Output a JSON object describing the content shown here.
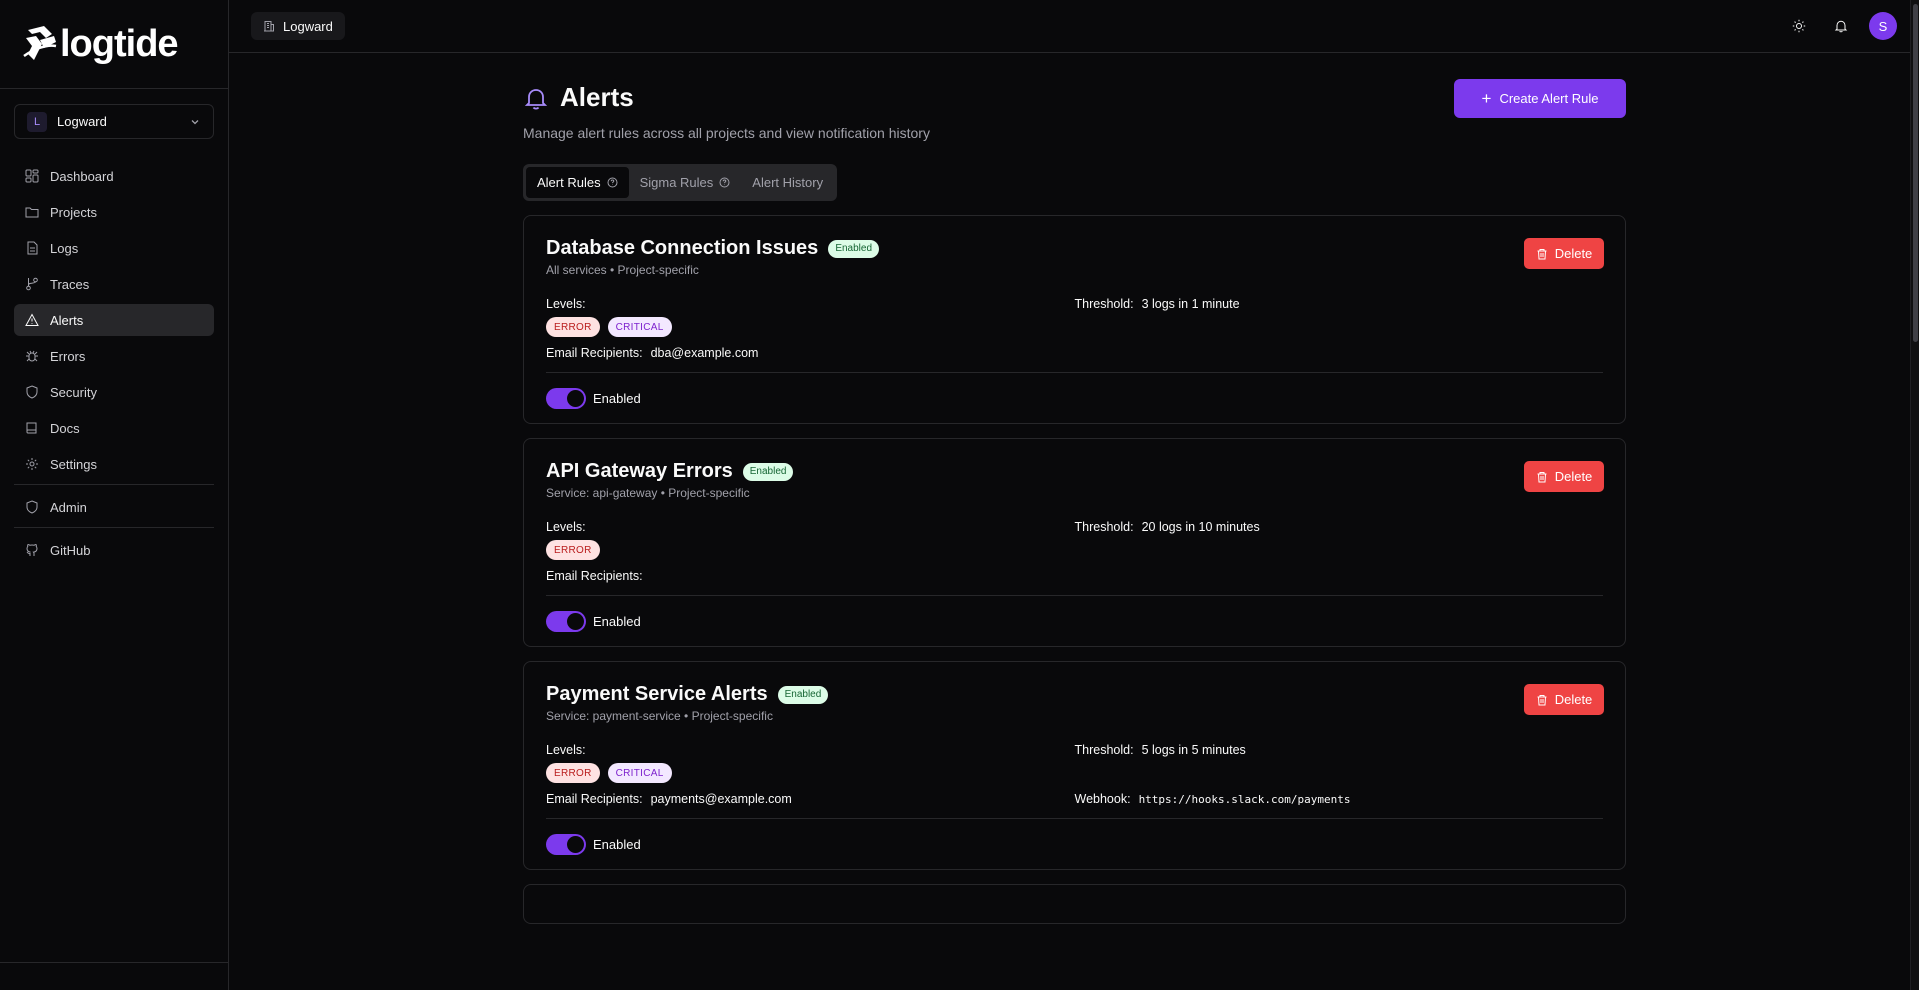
{
  "app": {
    "brand": "logtide"
  },
  "org_selector": {
    "initial": "L",
    "name": "Logward"
  },
  "sidebar": {
    "items": [
      {
        "label": "Dashboard",
        "icon": "dashboard-icon"
      },
      {
        "label": "Projects",
        "icon": "folder-icon"
      },
      {
        "label": "Logs",
        "icon": "file-text-icon"
      },
      {
        "label": "Traces",
        "icon": "git-branch-icon"
      },
      {
        "label": "Alerts",
        "icon": "alert-triangle-icon"
      },
      {
        "label": "Errors",
        "icon": "bug-icon"
      },
      {
        "label": "Security",
        "icon": "shield-icon"
      },
      {
        "label": "Docs",
        "icon": "book-icon"
      },
      {
        "label": "Settings",
        "icon": "gear-icon"
      }
    ],
    "admin": "Admin",
    "github": "GitHub"
  },
  "topbar": {
    "breadcrumb": "Logward",
    "user_initial": "S"
  },
  "page": {
    "title": "Alerts",
    "subtitle": "Manage alert rules across all projects and view notification history",
    "create_button": "Create Alert Rule"
  },
  "tabs": [
    "Alert Rules",
    "Sigma Rules",
    "Alert History"
  ],
  "labels": {
    "levels": "Levels:",
    "threshold": "Threshold:",
    "email": "Email Recipients:",
    "webhook": "Webhook:",
    "enabled_badge": "Enabled",
    "delete": "Delete",
    "toggle": "Enabled"
  },
  "rules": [
    {
      "name": "Database Connection Issues",
      "scope": "All services • Project-specific",
      "levels": [
        "ERROR",
        "CRITICAL"
      ],
      "threshold": "3 logs in 1 minute",
      "email": "dba@example.com",
      "webhook": ""
    },
    {
      "name": "API Gateway Errors",
      "scope": "Service: api-gateway • Project-specific",
      "levels": [
        "ERROR"
      ],
      "threshold": "20 logs in 10 minutes",
      "email": "",
      "webhook": ""
    },
    {
      "name": "Payment Service Alerts",
      "scope": "Service: payment-service • Project-specific",
      "levels": [
        "ERROR",
        "CRITICAL"
      ],
      "threshold": "5 logs in 5 minutes",
      "email": "payments@example.com",
      "webhook": "https://hooks.slack.com/payments"
    }
  ],
  "colors": {
    "accent": "#7c3aed",
    "danger": "#ef4444",
    "background": "#09090b",
    "border": "#27272a"
  }
}
